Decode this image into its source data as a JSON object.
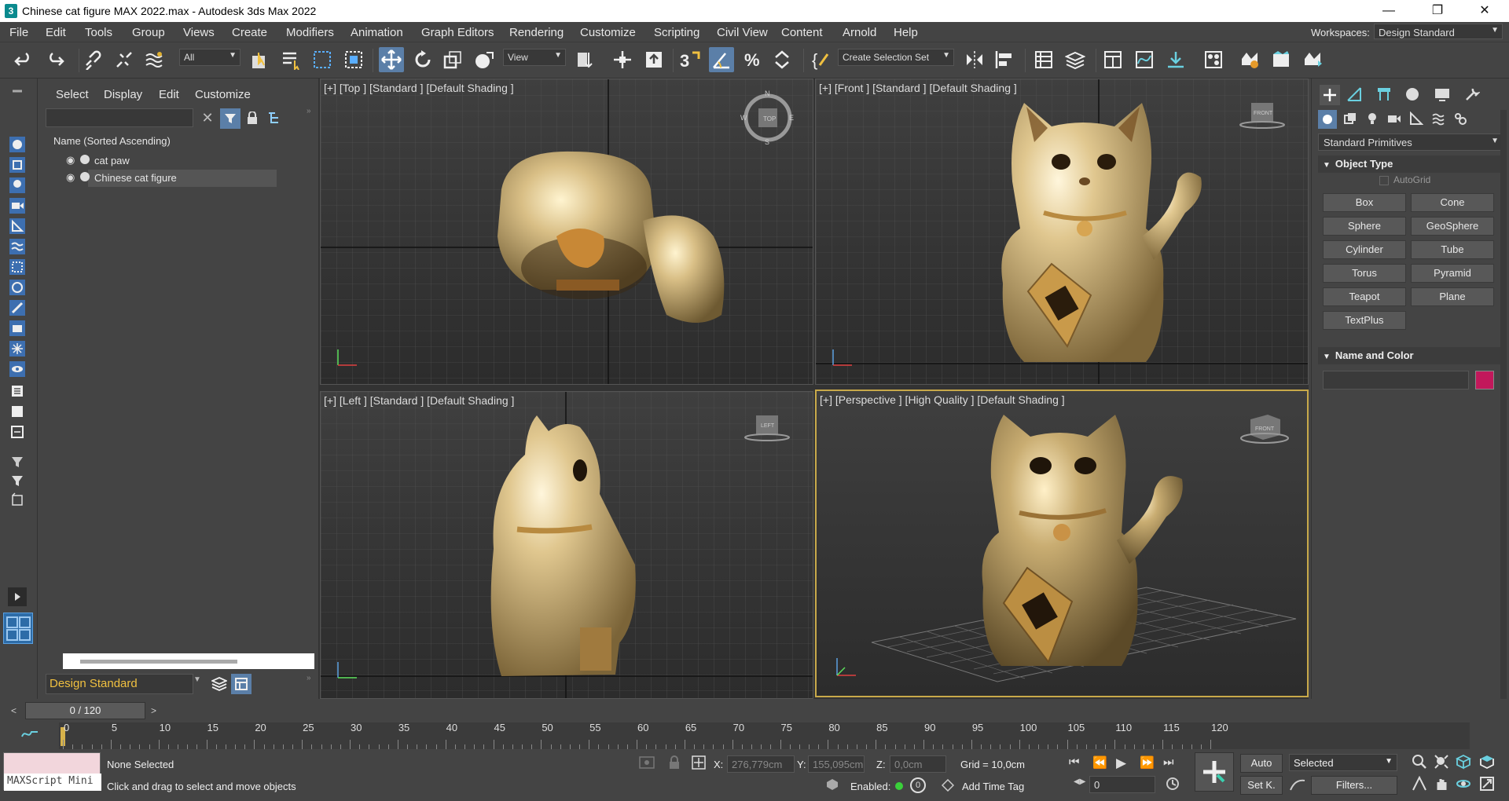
{
  "window": {
    "title": "Chinese cat figure MAX 2022.max - Autodesk 3ds Max 2022",
    "app_icon": "3",
    "controls": [
      "minimize-icon",
      "restore-icon",
      "close-icon"
    ]
  },
  "menu": [
    "File",
    "Edit",
    "Tools",
    "Group",
    "Views",
    "Create",
    "Modifiers",
    "Animation",
    "Graph Editors",
    "Rendering",
    "Customize",
    "Scripting",
    "Civil View",
    "Content",
    "Arnold",
    "Help"
  ],
  "workspaces": {
    "label": "Workspaces:",
    "value": "Design Standard"
  },
  "toolbar": {
    "filter": "All",
    "refcoord": "View",
    "selection_set": "Create Selection Set"
  },
  "scene_explorer": {
    "tabs": [
      "Select",
      "Display",
      "Edit",
      "Customize"
    ],
    "column_header": "Name (Sorted Ascending)",
    "items": [
      {
        "name": "cat paw"
      },
      {
        "name": "Chinese cat figure"
      }
    ],
    "workspace": "Design Standard"
  },
  "viewports": [
    {
      "label": "[+] [Top ] [Standard ] [Default Shading ]",
      "cube": "TOP"
    },
    {
      "label": "[+] [Front ] [Standard ] [Default Shading ]",
      "cube": "FRONT"
    },
    {
      "label": "[+] [Left ] [Standard ] [Default Shading ]",
      "cube": "LEFT"
    },
    {
      "label": "[+] [Perspective ] [High Quality ] [Default Shading ]",
      "cube": "FRONT"
    }
  ],
  "compass": {
    "n": "N",
    "s": "S",
    "e": "E",
    "w": "W"
  },
  "command_panel": {
    "category": "Standard Primitives",
    "object_type_header": "Object Type",
    "autogrid": "AutoGrid",
    "buttons": [
      "Box",
      "Cone",
      "Sphere",
      "GeoSphere",
      "Cylinder",
      "Tube",
      "Torus",
      "Pyramid",
      "Teapot",
      "Plane",
      "TextPlus"
    ],
    "name_color_header": "Name and Color",
    "color": "#c2185b"
  },
  "timeline": {
    "frame": "0 / 120",
    "prev": "<",
    "next": ">",
    "ticks": [
      "0",
      "5",
      "10",
      "15",
      "20",
      "25",
      "30",
      "35",
      "40",
      "45",
      "50",
      "55",
      "60",
      "65",
      "70",
      "75",
      "80",
      "85",
      "90",
      "95",
      "100",
      "105",
      "110",
      "115",
      "120"
    ]
  },
  "status": {
    "maxscript": "MAXScript Mini",
    "selection": "None Selected",
    "prompt": "Click and drag to select and move objects",
    "x_label": "X:",
    "x": "276,779cm",
    "y_label": "Y:",
    "y": "155,095cm",
    "z_label": "Z:",
    "z": "0,0cm",
    "grid": "Grid = 10,0cm",
    "enabled": "Enabled:",
    "enabled_value": "0",
    "add_time_tag": "Add Time Tag",
    "auto": "Auto",
    "set_key": "Set K.",
    "key_mode": "Selected",
    "filters": "Filters...",
    "frame_spinner": "0"
  }
}
